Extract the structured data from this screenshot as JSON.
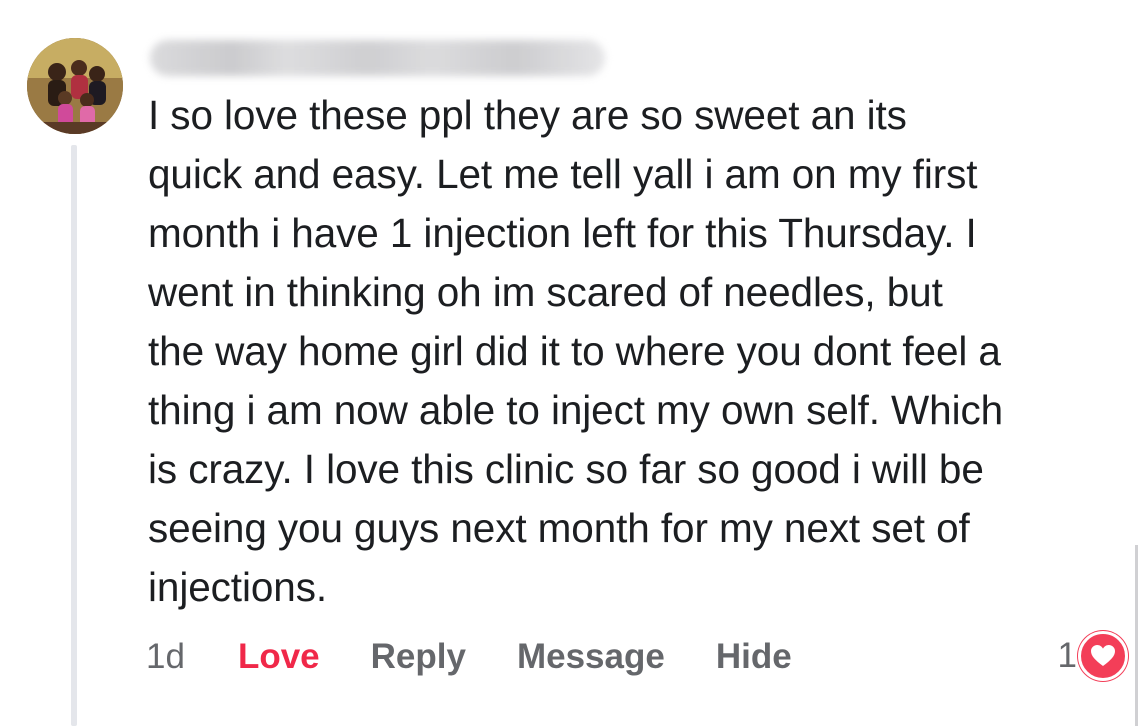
{
  "comment": {
    "author_name": "",
    "lines": [
      "I so love these ppl they are so sweet an its",
      "quick and easy. Let me tell yall i am on my first",
      "month i have 1 injection left for this Thursday. I",
      "went in thinking oh im scared of needles, but",
      "the way home girl did it to where you dont feel a",
      "thing i am now able to inject my own self. Which",
      "is crazy. I love this clinic so far so good i will be",
      "seeing you guys next month for my next set of",
      "injections."
    ]
  },
  "actions": {
    "timestamp": "1d",
    "love_label": "Love",
    "reply_label": "Reply",
    "message_label": "Message",
    "hide_label": "Hide"
  },
  "reactions": {
    "count": "1",
    "type": "love-heart-icon"
  },
  "colors": {
    "love_active": "#f02849",
    "action_gray": "#65676b",
    "text": "#1c1e21",
    "heart_badge": "#f33e58"
  }
}
